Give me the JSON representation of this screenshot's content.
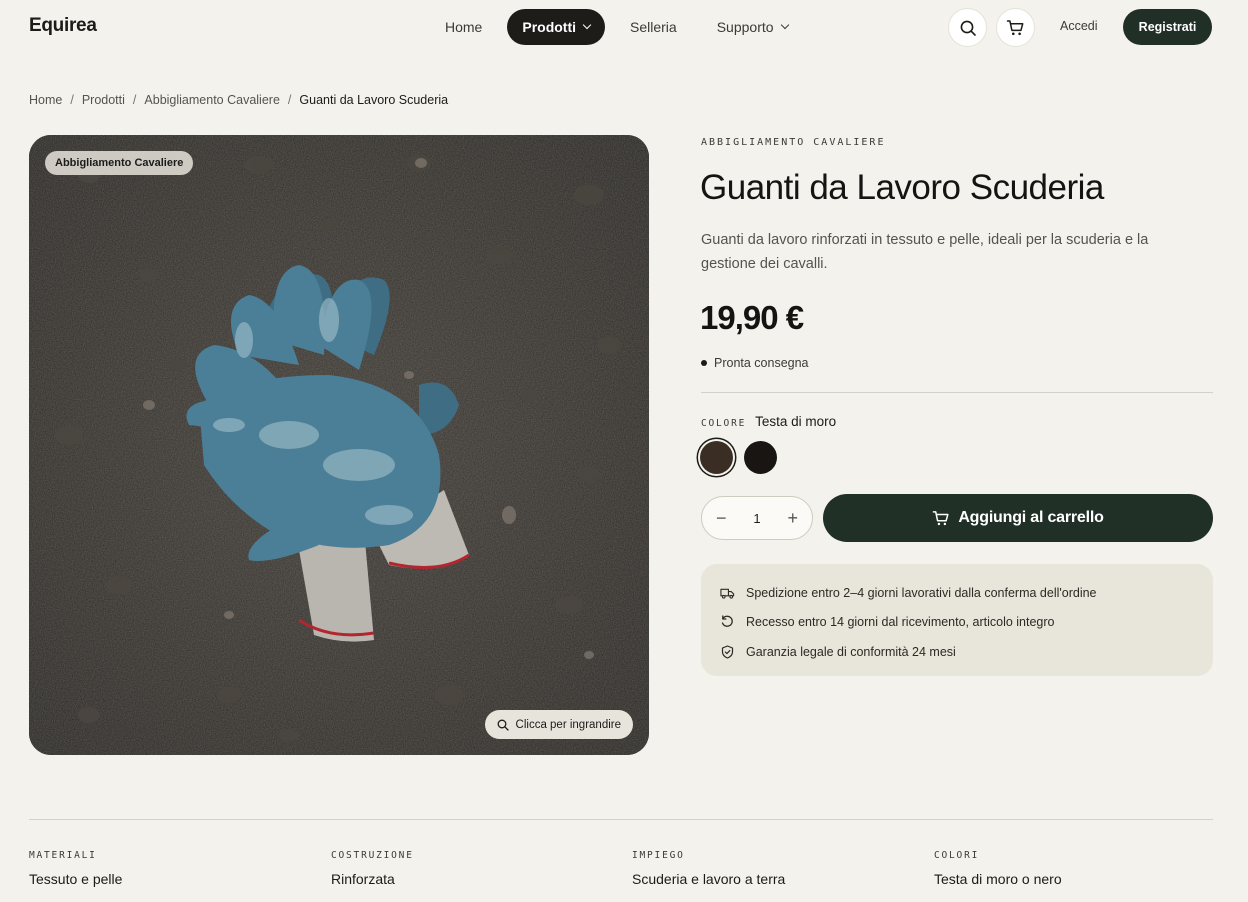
{
  "header": {
    "logo": "Equirea",
    "nav": [
      {
        "label": "Home",
        "active": false,
        "dropdown": false
      },
      {
        "label": "Prodotti",
        "active": true,
        "dropdown": true
      },
      {
        "label": "Selleria",
        "active": false,
        "dropdown": false
      },
      {
        "label": "Supporto",
        "active": false,
        "dropdown": true
      }
    ],
    "icons": [
      "search-icon",
      "cart-icon"
    ],
    "login_label": "Accedi",
    "register_label": "Registrati"
  },
  "breadcrumb": [
    "Home",
    "Prodotti",
    "Abbigliamento Cavaliere",
    "Guanti da Lavoro Scuderia"
  ],
  "gallery": {
    "badge": "Abbigliamento Cavaliere",
    "zoom_label": "Clicca per ingrandire"
  },
  "product": {
    "category": "ABBIGLIAMENTO CAVALIERE",
    "title": "Guanti da Lavoro Scuderia",
    "description": "Guanti da lavoro rinforzati in tessuto e pelle, ideali per la scuderia e la gestione dei cavalli.",
    "price": "19,90 €",
    "stock": "Pronta consegna",
    "color_label": "COLORE",
    "color_value": "Testa di moro",
    "swatches": [
      {
        "name": "Testa di moro",
        "color": "#3a2d24",
        "selected": true
      },
      {
        "name": "Nero",
        "color": "#181512",
        "selected": false
      }
    ],
    "quantity": "1",
    "add_to_cart": "Aggiungi al carrello"
  },
  "info": [
    {
      "icon": "truck-icon",
      "text": "Spedizione entro 2–4 giorni lavorativi dalla conferma dell'ordine"
    },
    {
      "icon": "return-icon",
      "text": "Recesso entro 14 giorni dal ricevimento, articolo integro"
    },
    {
      "icon": "shield-icon",
      "text": "Garanzia legale di conformità 24 mesi"
    }
  ],
  "specs": [
    {
      "key": "MATERIALI",
      "value": "Tessuto e pelle"
    },
    {
      "key": "COSTRUZIONE",
      "value": "Rinforzata"
    },
    {
      "key": "IMPIEGO",
      "value": "Scuderia e lavoro a terra"
    },
    {
      "key": "COLORI",
      "value": "Testa di moro o nero"
    }
  ],
  "colors": {
    "accent": "#213027",
    "background": "#f4f2ec",
    "panel": "#e8e5db"
  }
}
